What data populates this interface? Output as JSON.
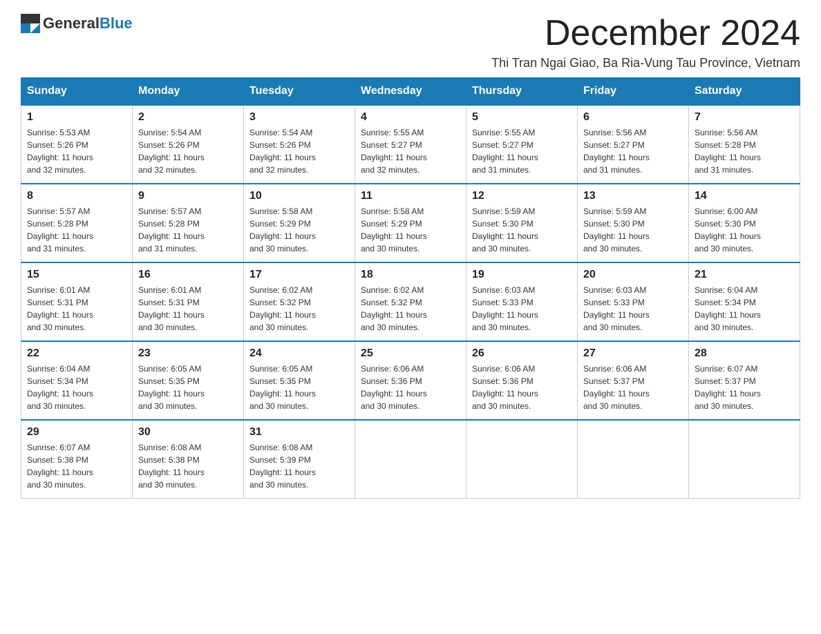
{
  "logo": {
    "general": "General",
    "blue": "Blue"
  },
  "title": "December 2024",
  "location": "Thi Tran Ngai Giao, Ba Ria-Vung Tau Province, Vietnam",
  "weekdays": [
    "Sunday",
    "Monday",
    "Tuesday",
    "Wednesday",
    "Thursday",
    "Friday",
    "Saturday"
  ],
  "weeks": [
    [
      {
        "day": "1",
        "sunrise": "5:53 AM",
        "sunset": "5:26 PM",
        "daylight": "11 hours and 32 minutes."
      },
      {
        "day": "2",
        "sunrise": "5:54 AM",
        "sunset": "5:26 PM",
        "daylight": "11 hours and 32 minutes."
      },
      {
        "day": "3",
        "sunrise": "5:54 AM",
        "sunset": "5:26 PM",
        "daylight": "11 hours and 32 minutes."
      },
      {
        "day": "4",
        "sunrise": "5:55 AM",
        "sunset": "5:27 PM",
        "daylight": "11 hours and 32 minutes."
      },
      {
        "day": "5",
        "sunrise": "5:55 AM",
        "sunset": "5:27 PM",
        "daylight": "11 hours and 31 minutes."
      },
      {
        "day": "6",
        "sunrise": "5:56 AM",
        "sunset": "5:27 PM",
        "daylight": "11 hours and 31 minutes."
      },
      {
        "day": "7",
        "sunrise": "5:56 AM",
        "sunset": "5:28 PM",
        "daylight": "11 hours and 31 minutes."
      }
    ],
    [
      {
        "day": "8",
        "sunrise": "5:57 AM",
        "sunset": "5:28 PM",
        "daylight": "11 hours and 31 minutes."
      },
      {
        "day": "9",
        "sunrise": "5:57 AM",
        "sunset": "5:28 PM",
        "daylight": "11 hours and 31 minutes."
      },
      {
        "day": "10",
        "sunrise": "5:58 AM",
        "sunset": "5:29 PM",
        "daylight": "11 hours and 30 minutes."
      },
      {
        "day": "11",
        "sunrise": "5:58 AM",
        "sunset": "5:29 PM",
        "daylight": "11 hours and 30 minutes."
      },
      {
        "day": "12",
        "sunrise": "5:59 AM",
        "sunset": "5:30 PM",
        "daylight": "11 hours and 30 minutes."
      },
      {
        "day": "13",
        "sunrise": "5:59 AM",
        "sunset": "5:30 PM",
        "daylight": "11 hours and 30 minutes."
      },
      {
        "day": "14",
        "sunrise": "6:00 AM",
        "sunset": "5:30 PM",
        "daylight": "11 hours and 30 minutes."
      }
    ],
    [
      {
        "day": "15",
        "sunrise": "6:01 AM",
        "sunset": "5:31 PM",
        "daylight": "11 hours and 30 minutes."
      },
      {
        "day": "16",
        "sunrise": "6:01 AM",
        "sunset": "5:31 PM",
        "daylight": "11 hours and 30 minutes."
      },
      {
        "day": "17",
        "sunrise": "6:02 AM",
        "sunset": "5:32 PM",
        "daylight": "11 hours and 30 minutes."
      },
      {
        "day": "18",
        "sunrise": "6:02 AM",
        "sunset": "5:32 PM",
        "daylight": "11 hours and 30 minutes."
      },
      {
        "day": "19",
        "sunrise": "6:03 AM",
        "sunset": "5:33 PM",
        "daylight": "11 hours and 30 minutes."
      },
      {
        "day": "20",
        "sunrise": "6:03 AM",
        "sunset": "5:33 PM",
        "daylight": "11 hours and 30 minutes."
      },
      {
        "day": "21",
        "sunrise": "6:04 AM",
        "sunset": "5:34 PM",
        "daylight": "11 hours and 30 minutes."
      }
    ],
    [
      {
        "day": "22",
        "sunrise": "6:04 AM",
        "sunset": "5:34 PM",
        "daylight": "11 hours and 30 minutes."
      },
      {
        "day": "23",
        "sunrise": "6:05 AM",
        "sunset": "5:35 PM",
        "daylight": "11 hours and 30 minutes."
      },
      {
        "day": "24",
        "sunrise": "6:05 AM",
        "sunset": "5:35 PM",
        "daylight": "11 hours and 30 minutes."
      },
      {
        "day": "25",
        "sunrise": "6:06 AM",
        "sunset": "5:36 PM",
        "daylight": "11 hours and 30 minutes."
      },
      {
        "day": "26",
        "sunrise": "6:06 AM",
        "sunset": "5:36 PM",
        "daylight": "11 hours and 30 minutes."
      },
      {
        "day": "27",
        "sunrise": "6:06 AM",
        "sunset": "5:37 PM",
        "daylight": "11 hours and 30 minutes."
      },
      {
        "day": "28",
        "sunrise": "6:07 AM",
        "sunset": "5:37 PM",
        "daylight": "11 hours and 30 minutes."
      }
    ],
    [
      {
        "day": "29",
        "sunrise": "6:07 AM",
        "sunset": "5:38 PM",
        "daylight": "11 hours and 30 minutes."
      },
      {
        "day": "30",
        "sunrise": "6:08 AM",
        "sunset": "5:38 PM",
        "daylight": "11 hours and 30 minutes."
      },
      {
        "day": "31",
        "sunrise": "6:08 AM",
        "sunset": "5:39 PM",
        "daylight": "11 hours and 30 minutes."
      },
      null,
      null,
      null,
      null
    ]
  ],
  "labels": {
    "sunrise": "Sunrise:",
    "sunset": "Sunset:",
    "daylight": "Daylight:"
  }
}
